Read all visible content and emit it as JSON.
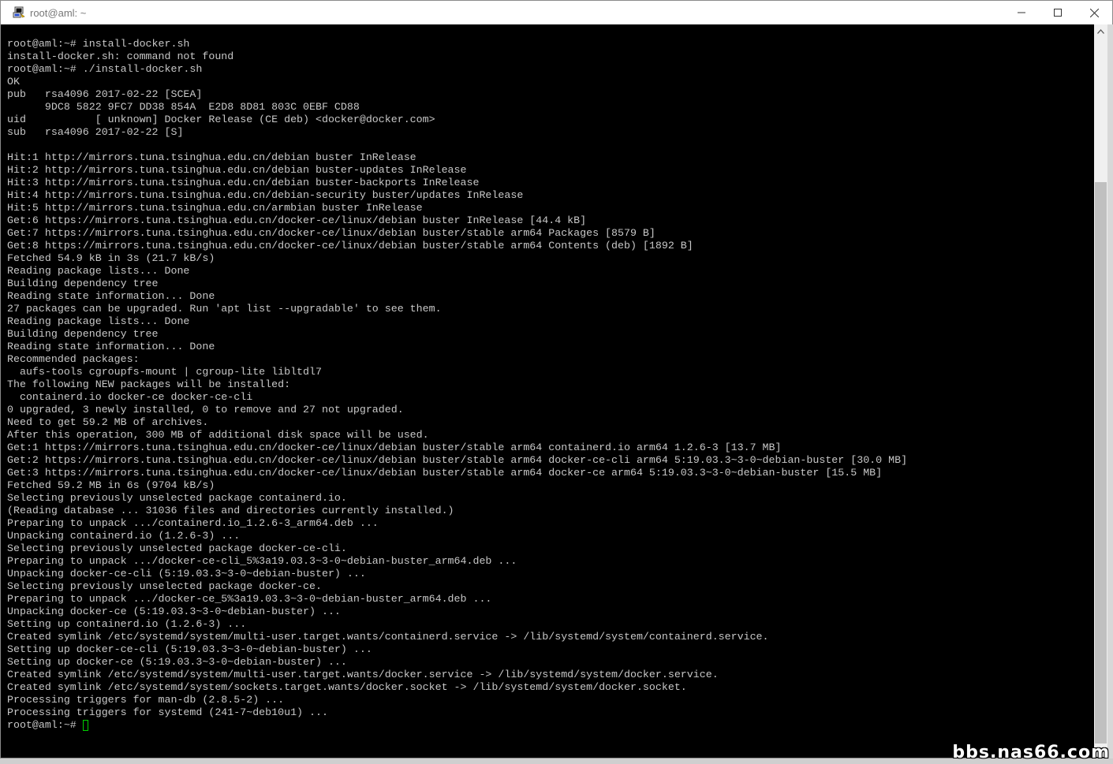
{
  "window": {
    "title": "root@aml: ~"
  },
  "terminal": {
    "lines": [
      "root@aml:~# install-docker.sh",
      "install-docker.sh: command not found",
      "root@aml:~# ./install-docker.sh",
      "OK",
      "pub   rsa4096 2017-02-22 [SCEA]",
      "      9DC8 5822 9FC7 DD38 854A  E2D8 8D81 803C 0EBF CD88",
      "uid           [ unknown] Docker Release (CE deb) <docker@docker.com>",
      "sub   rsa4096 2017-02-22 [S]",
      "",
      "Hit:1 http://mirrors.tuna.tsinghua.edu.cn/debian buster InRelease",
      "Hit:2 http://mirrors.tuna.tsinghua.edu.cn/debian buster-updates InRelease",
      "Hit:3 http://mirrors.tuna.tsinghua.edu.cn/debian buster-backports InRelease",
      "Hit:4 http://mirrors.tuna.tsinghua.edu.cn/debian-security buster/updates InRelease",
      "Hit:5 http://mirrors.tuna.tsinghua.edu.cn/armbian buster InRelease",
      "Get:6 https://mirrors.tuna.tsinghua.edu.cn/docker-ce/linux/debian buster InRelease [44.4 kB]",
      "Get:7 https://mirrors.tuna.tsinghua.edu.cn/docker-ce/linux/debian buster/stable arm64 Packages [8579 B]",
      "Get:8 https://mirrors.tuna.tsinghua.edu.cn/docker-ce/linux/debian buster/stable arm64 Contents (deb) [1892 B]",
      "Fetched 54.9 kB in 3s (21.7 kB/s)",
      "Reading package lists... Done",
      "Building dependency tree",
      "Reading state information... Done",
      "27 packages can be upgraded. Run 'apt list --upgradable' to see them.",
      "Reading package lists... Done",
      "Building dependency tree",
      "Reading state information... Done",
      "Recommended packages:",
      "  aufs-tools cgroupfs-mount | cgroup-lite libltdl7",
      "The following NEW packages will be installed:",
      "  containerd.io docker-ce docker-ce-cli",
      "0 upgraded, 3 newly installed, 0 to remove and 27 not upgraded.",
      "Need to get 59.2 MB of archives.",
      "After this operation, 300 MB of additional disk space will be used.",
      "Get:1 https://mirrors.tuna.tsinghua.edu.cn/docker-ce/linux/debian buster/stable arm64 containerd.io arm64 1.2.6-3 [13.7 MB]",
      "Get:2 https://mirrors.tuna.tsinghua.edu.cn/docker-ce/linux/debian buster/stable arm64 docker-ce-cli arm64 5:19.03.3~3-0~debian-buster [30.0 MB]",
      "Get:3 https://mirrors.tuna.tsinghua.edu.cn/docker-ce/linux/debian buster/stable arm64 docker-ce arm64 5:19.03.3~3-0~debian-buster [15.5 MB]",
      "Fetched 59.2 MB in 6s (9704 kB/s)",
      "Selecting previously unselected package containerd.io.",
      "(Reading database ... 31036 files and directories currently installed.)",
      "Preparing to unpack .../containerd.io_1.2.6-3_arm64.deb ...",
      "Unpacking containerd.io (1.2.6-3) ...",
      "Selecting previously unselected package docker-ce-cli.",
      "Preparing to unpack .../docker-ce-cli_5%3a19.03.3~3-0~debian-buster_arm64.deb ...",
      "Unpacking docker-ce-cli (5:19.03.3~3-0~debian-buster) ...",
      "Selecting previously unselected package docker-ce.",
      "Preparing to unpack .../docker-ce_5%3a19.03.3~3-0~debian-buster_arm64.deb ...",
      "Unpacking docker-ce (5:19.03.3~3-0~debian-buster) ...",
      "Setting up containerd.io (1.2.6-3) ...",
      "Created symlink /etc/systemd/system/multi-user.target.wants/containerd.service -> /lib/systemd/system/containerd.service.",
      "Setting up docker-ce-cli (5:19.03.3~3-0~debian-buster) ...",
      "Setting up docker-ce (5:19.03.3~3-0~debian-buster) ...",
      "Created symlink /etc/systemd/system/multi-user.target.wants/docker.service -> /lib/systemd/system/docker.service.",
      "Created symlink /etc/systemd/system/sockets.target.wants/docker.socket -> /lib/systemd/system/docker.socket.",
      "Processing triggers for man-db (2.8.5-2) ...",
      "Processing triggers for systemd (241-7~deb10u1) ..."
    ],
    "prompt": "root@aml:~#",
    "cursor_color": "#00d000"
  },
  "icons": {
    "app": "putty-terminal-icon",
    "minimize": "minimize-icon",
    "maximize": "maximize-icon",
    "close": "close-icon",
    "scroll_up": "scroll-up-arrow-icon",
    "scroll_down": "scroll-down-arrow-icon"
  },
  "watermark": "bbs.nas66.com"
}
